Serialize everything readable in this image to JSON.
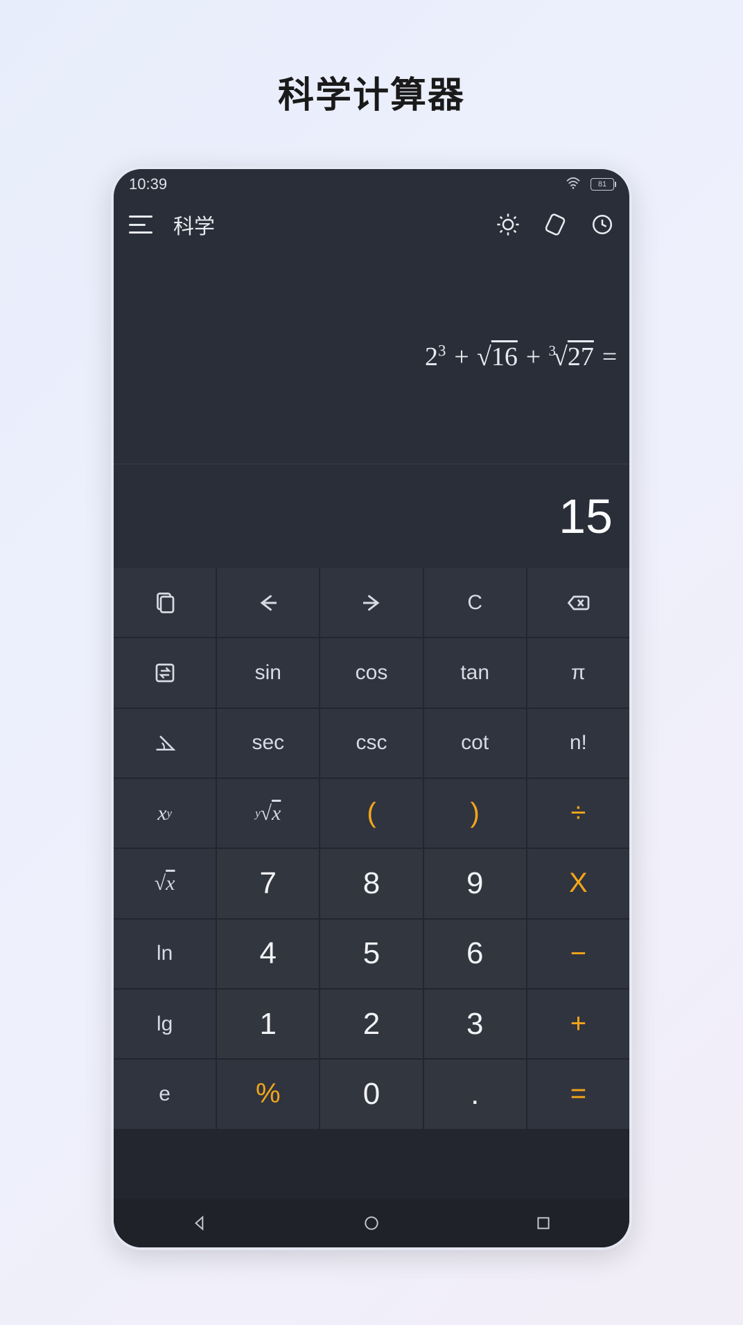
{
  "page": {
    "title": "科学计算器"
  },
  "status": {
    "time": "10:39",
    "battery": "81"
  },
  "header": {
    "title": "科学"
  },
  "expression": {
    "base1": "2",
    "exp1": "3",
    "plus1": " + ",
    "sqrt_arg": "16",
    "plus2": " + ",
    "cbrt_deg": "3",
    "cbrt_arg": "27",
    "eq": " ="
  },
  "result": "15",
  "keys": {
    "r1": {
      "copy": "",
      "left": "",
      "right": "",
      "clear": "C",
      "backspace": ""
    },
    "r2": {
      "swap": "",
      "sin": "sin",
      "cos": "cos",
      "tan": "tan",
      "pi": "π"
    },
    "r3": {
      "angle": "",
      "sec": "sec",
      "csc": "csc",
      "cot": "cot",
      "fact": "n!"
    },
    "r4": {
      "xy_base": "x",
      "xy_exp": "y",
      "yroot_deg": "y",
      "yroot_x": "x",
      "lparen": "(",
      "rparen": ")",
      "div": "÷"
    },
    "r5": {
      "sqrt_x": "x",
      "n7": "7",
      "n8": "8",
      "n9": "9",
      "mul": "X"
    },
    "r6": {
      "ln": "ln",
      "n4": "4",
      "n5": "5",
      "n6": "6",
      "sub": "−"
    },
    "r7": {
      "lg": "lg",
      "n1": "1",
      "n2": "2",
      "n3": "3",
      "add": "+"
    },
    "r8": {
      "e": "e",
      "pct": "%",
      "n0": "0",
      "dot": ".",
      "eq": "="
    }
  }
}
